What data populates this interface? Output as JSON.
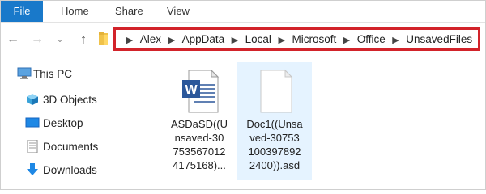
{
  "ribbon": {
    "tabs": [
      {
        "label": "File",
        "active": true
      },
      {
        "label": "Home"
      },
      {
        "label": "Share"
      },
      {
        "label": "View"
      }
    ]
  },
  "nav": {
    "back_icon": "arrow-left-icon",
    "forward_icon": "arrow-right-icon",
    "recent_icon": "chevron-down-icon",
    "up_icon": "arrow-up-icon"
  },
  "address": {
    "highlight_color": "#d2232a",
    "crumbs": [
      "Alex",
      "AppData",
      "Local",
      "Microsoft",
      "Office",
      "UnsavedFiles"
    ]
  },
  "sidebar": {
    "items": [
      {
        "label": "This PC",
        "icon": "computer-icon"
      },
      {
        "label": "3D Objects",
        "icon": "cube-icon"
      },
      {
        "label": "Desktop",
        "icon": "desktop-icon"
      },
      {
        "label": "Documents",
        "icon": "documents-icon"
      },
      {
        "label": "Downloads",
        "icon": "download-icon"
      }
    ]
  },
  "files": [
    {
      "icon": "word-document-icon",
      "name_lines": [
        "ASDaSD((U",
        "nsaved-30",
        "753567012",
        "4175168)..."
      ],
      "selected": false
    },
    {
      "icon": "blank-file-icon",
      "name_lines": [
        "Doc1((Unsa",
        "ved-30753",
        "100397892",
        "2400)).asd"
      ],
      "selected": true
    }
  ],
  "colors": {
    "file_tab": "#1979ca",
    "selection": "#e5f3ff",
    "word_blue": "#2b579a"
  }
}
